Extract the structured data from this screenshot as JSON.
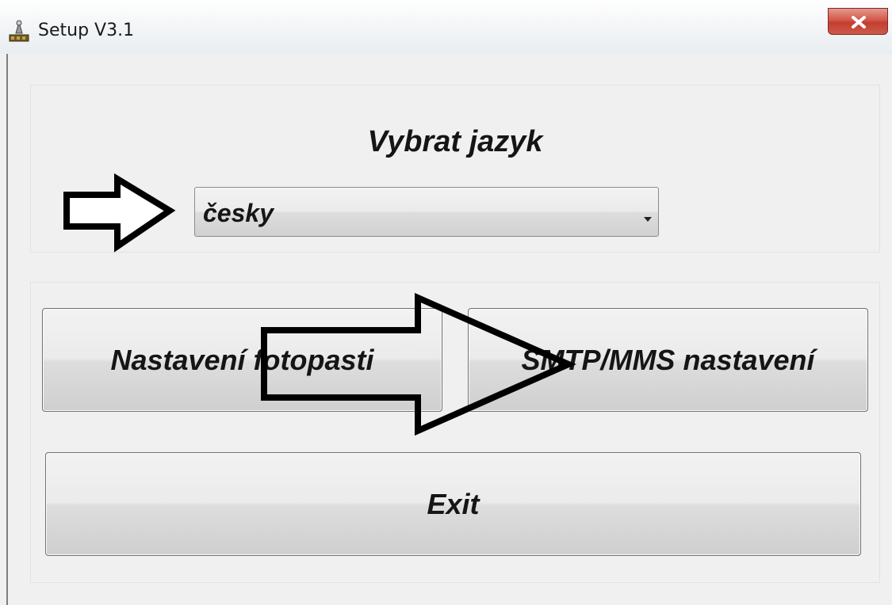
{
  "window": {
    "title": "Setup V3.1",
    "close_label": "x"
  },
  "language": {
    "heading": "Vybrat jazyk",
    "selected": "česky"
  },
  "buttons": {
    "camera_setup": "Nastavení fotopasti",
    "smtp_setup": "SMTP/MMS nastavení",
    "exit": "Exit"
  },
  "icons": {
    "app": "setup-tool-icon",
    "close": "close-icon",
    "dropdown": "chevron-down-icon",
    "annotation_arrows": "right-arrow-icon"
  },
  "colors": {
    "window_bg": "#f0f0f0",
    "close_button": "#c13e30",
    "annotation_stroke": "#000000"
  }
}
